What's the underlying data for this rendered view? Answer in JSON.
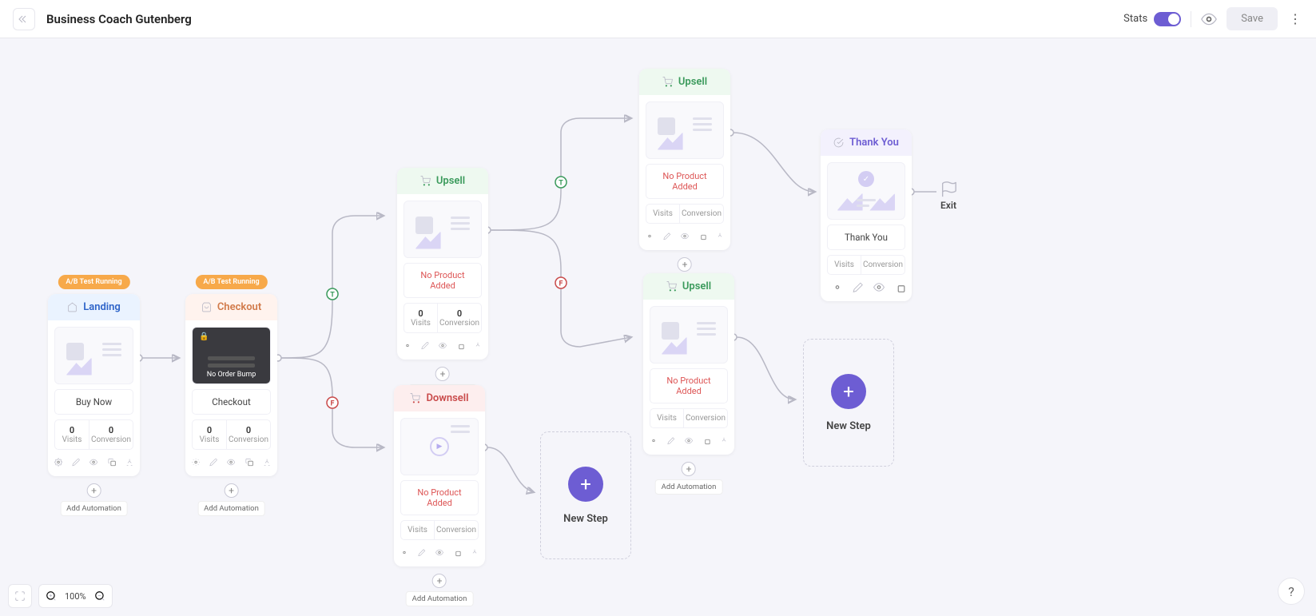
{
  "header": {
    "title": "Business Coach Gutenberg",
    "stats_label": "Stats",
    "save_label": "Save"
  },
  "badges": {
    "ab_running": "A/B Test Running"
  },
  "labels": {
    "visits": "Visits",
    "conversion": "Conversion",
    "add_automation": "Add Automation",
    "new_step": "New Step",
    "exit": "Exit",
    "no_product": "No Product Added",
    "no_order_bump": "No Order Bump"
  },
  "zoom": {
    "pct": "100%"
  },
  "nodes": {
    "landing": {
      "type": "Landing",
      "label": "Buy Now",
      "visits": "0",
      "conversion": "0",
      "ab": true
    },
    "checkout": {
      "type": "Checkout",
      "label": "Checkout",
      "visits": "0",
      "conversion": "0",
      "ab": true
    },
    "upsell1": {
      "type": "Upsell",
      "warn": true,
      "visits": "0",
      "conversion": "0"
    },
    "downsell": {
      "type": "Downsell",
      "warn": true,
      "visits": "",
      "conversion": ""
    },
    "upsell2": {
      "type": "Upsell",
      "warn": true,
      "visits": "",
      "conversion": ""
    },
    "upsell3": {
      "type": "Upsell",
      "warn": true,
      "visits": "",
      "conversion": ""
    },
    "thankyou": {
      "type": "Thank You",
      "label": "Thank You",
      "visits": "",
      "conversion": ""
    }
  }
}
